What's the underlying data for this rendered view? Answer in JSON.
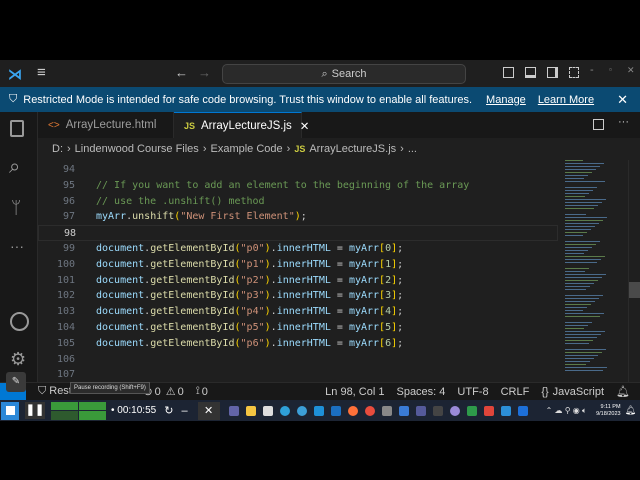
{
  "titlebar": {
    "search_placeholder": "Search"
  },
  "banner": {
    "message": "Restricted Mode is intended for safe code browsing. Trust this window to enable all features.",
    "manage": "Manage",
    "learn_more": "Learn More"
  },
  "tabs": [
    {
      "label": "ArrayLecture.html",
      "icon": "<>"
    },
    {
      "label": "ArrayLectureJS.js",
      "icon": "JS"
    }
  ],
  "breadcrumb": [
    "D:",
    "Lindenwood Course Files",
    "Example Code",
    "ArrayLectureJS.js",
    "..."
  ],
  "breadcrumb_icon": "JS",
  "editor": {
    "lines": [
      {
        "n": "94",
        "t": ""
      },
      {
        "n": "95",
        "t": "// If you want to add an element to the beginning of the array"
      },
      {
        "n": "96",
        "t": "// use the .unshift() method"
      },
      {
        "n": "97",
        "t": "myArr.unshift(\"New First Element\");"
      },
      {
        "n": "98",
        "t": ""
      },
      {
        "n": "99",
        "t": "document.getElementById(\"p0\").innerHTML = myArr[0];"
      },
      {
        "n": "100",
        "t": "document.getElementById(\"p1\").innerHTML = myArr[1];"
      },
      {
        "n": "101",
        "t": "document.getElementById(\"p2\").innerHTML = myArr[2];"
      },
      {
        "n": "102",
        "t": "document.getElementById(\"p3\").innerHTML = myArr[3];"
      },
      {
        "n": "103",
        "t": "document.getElementById(\"p4\").innerHTML = myArr[4];"
      },
      {
        "n": "104",
        "t": "document.getElementById(\"p5\").innerHTML = myArr[5];"
      },
      {
        "n": "105",
        "t": "document.getElementById(\"p6\").innerHTML = myArr[6];"
      },
      {
        "n": "106",
        "t": ""
      },
      {
        "n": "107",
        "t": ""
      }
    ]
  },
  "status": {
    "restricted": "Restricted Mode",
    "errors": "0",
    "warnings": "0",
    "ports": "0",
    "position": "Ln 98, Col 1",
    "spaces": "Spaces: 4",
    "encoding": "UTF-8",
    "eol": "CRLF",
    "language": "JavaScript",
    "language_icon": "{}"
  },
  "recorder": {
    "tooltip": "Pause recording (Shift+F9)",
    "time": "00:10:55"
  },
  "clock": {
    "time": "9:11 PM",
    "date": "9/18/2023"
  },
  "colors": {
    "accent": "#0078d4",
    "banner": "#0b4a72"
  }
}
